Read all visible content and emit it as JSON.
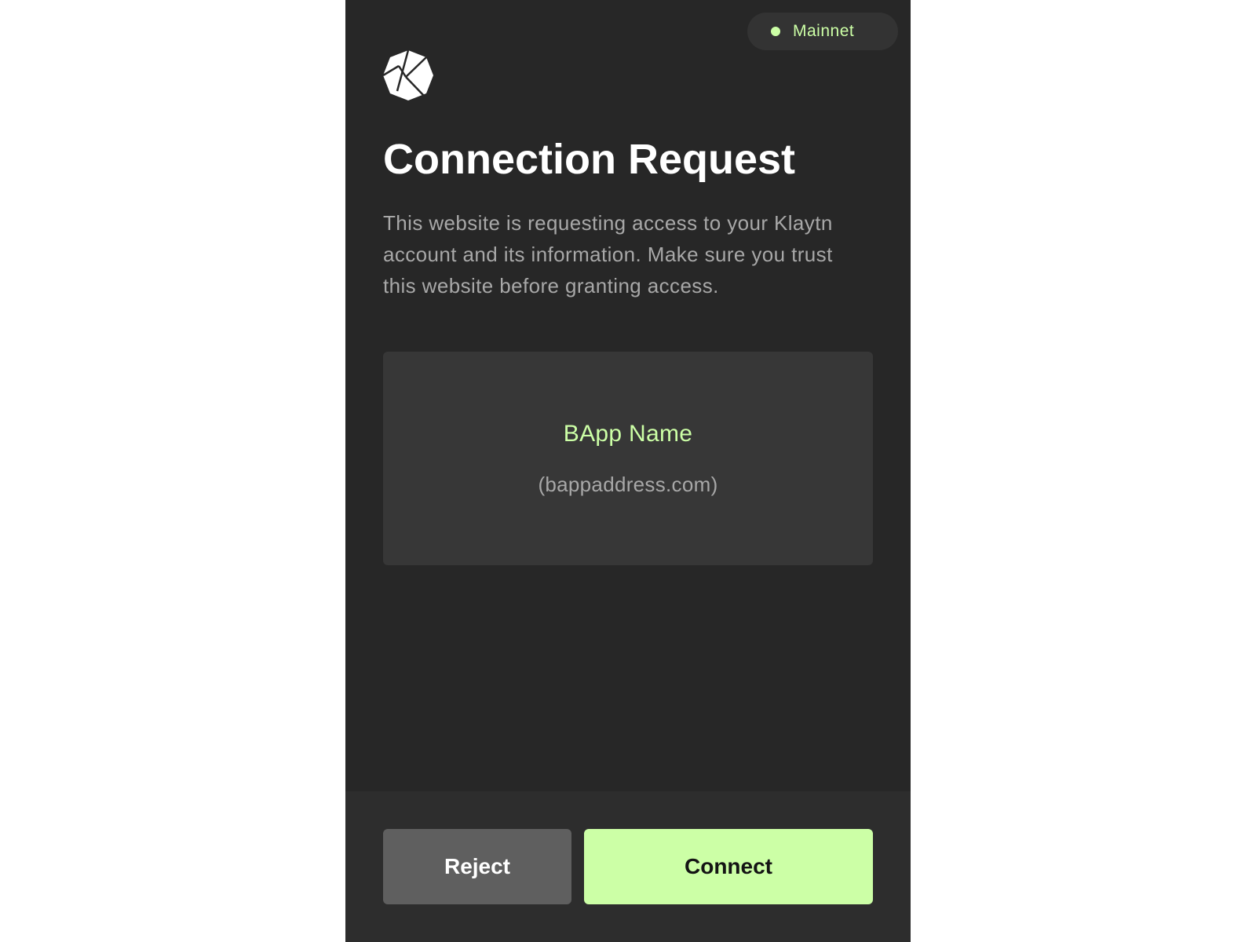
{
  "colors": {
    "accent": "#ccffa6",
    "panel_background": "#272727",
    "card_background": "#373737",
    "muted_text": "#a8a8a8",
    "reject_button": "#5f5f5f"
  },
  "network": {
    "label": "Mainnet",
    "status_icon": "green-dot"
  },
  "logo": {
    "icon": "klaytn-logo"
  },
  "header": {
    "title": "Connection Request",
    "description": "This website is requesting access to your Klaytn account and its information. Make sure you trust this website before granting access."
  },
  "bapp": {
    "name": "BApp Name",
    "address": "(bappaddress.com)"
  },
  "actions": {
    "reject_label": "Reject",
    "connect_label": "Connect"
  }
}
